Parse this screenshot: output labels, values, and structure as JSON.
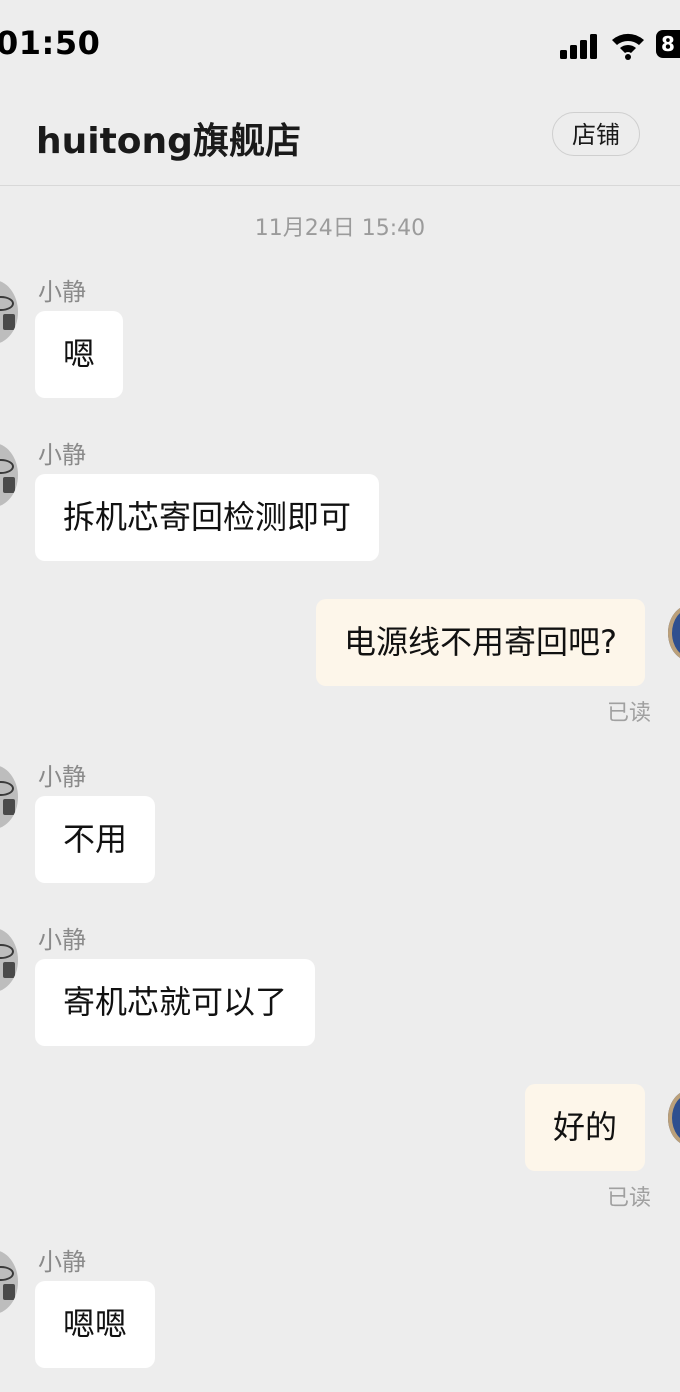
{
  "status_bar": {
    "time": "01:50",
    "battery": "8"
  },
  "header": {
    "title": "huitong旗舰店",
    "store_button": "店铺"
  },
  "chat": {
    "timestamp": "11月24日 15:40",
    "messages": [
      {
        "direction": "in",
        "sender": "小静",
        "text": "嗯"
      },
      {
        "direction": "in",
        "sender": "小静",
        "text": "拆机芯寄回检测即可"
      },
      {
        "direction": "out",
        "text": "电源线不用寄回吧?",
        "status": "已读"
      },
      {
        "direction": "in",
        "sender": "小静",
        "text": "不用"
      },
      {
        "direction": "in",
        "sender": "小静",
        "text": "寄机芯就可以了"
      },
      {
        "direction": "out",
        "text": "好的",
        "status": "已读"
      },
      {
        "direction": "in",
        "sender": "小静",
        "text": "嗯嗯"
      }
    ]
  }
}
